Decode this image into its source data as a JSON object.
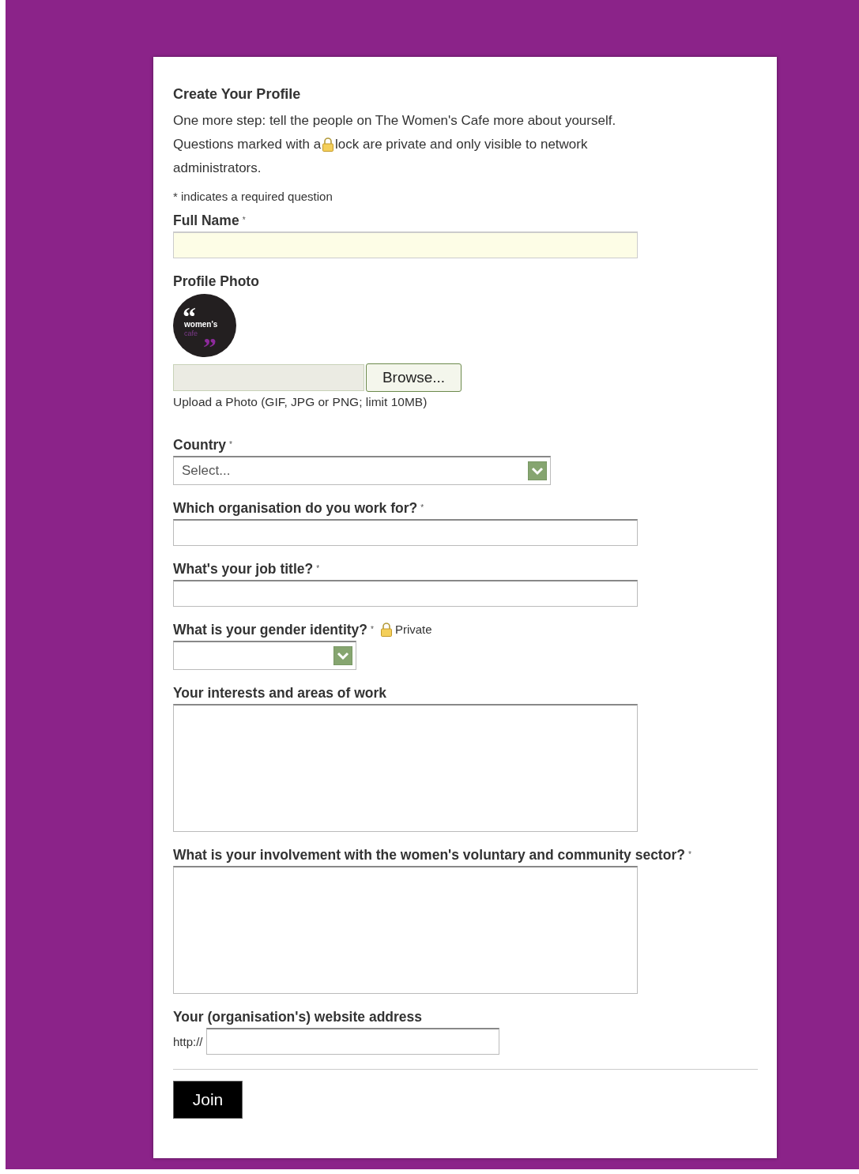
{
  "title": "Create Your Profile",
  "intro_line_1": "One more step: tell the people on The Women's Cafe more about yourself.",
  "intro_line_2_start": "Questions marked with a",
  "intro_line_2_end": "lock are private and only visible to network",
  "intro_line_3": "administrators.",
  "required_note": "* indicates a required question",
  "required_mark": "*",
  "private_label": "Private",
  "fields": [
    {
      "kind": "text",
      "label": "Full Name",
      "required": true,
      "focused": true
    },
    {
      "kind": "photo",
      "label": "Profile Photo",
      "required": false,
      "logo": {
        "open_quote": "“",
        "line_1": "women's",
        "line_2": "cafe",
        "close_quote": "”"
      },
      "button": "Browse...",
      "hint": "Upload a Photo (GIF, JPG or PNG; limit 10MB)"
    },
    {
      "kind": "select",
      "label": "Country",
      "required": true,
      "value": "Select..."
    },
    {
      "kind": "text",
      "label": "Which organisation do you work for?",
      "required": true,
      "focused": false
    },
    {
      "kind": "text",
      "label": "What's your job title?",
      "required": true,
      "focused": false
    },
    {
      "kind": "select",
      "label": "What is your gender identity?",
      "required": true,
      "private": true
    },
    {
      "kind": "textarea",
      "label": "Your interests and areas of work",
      "required": false
    },
    {
      "kind": "textarea",
      "label": "What is your involvement with the women's voluntary and community sector?",
      "required": true
    },
    {
      "kind": "url",
      "label": "Your (organisation's) website address",
      "required": false,
      "prefix": "http://"
    }
  ],
  "submit": "Join"
}
